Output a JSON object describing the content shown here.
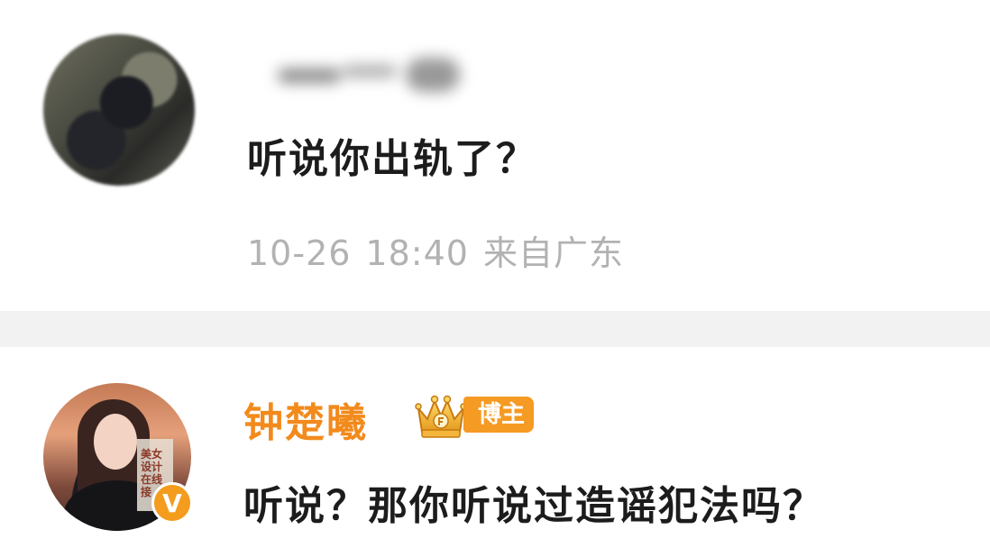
{
  "comment_1": {
    "username": "",
    "text": "听说你出轨了？",
    "date": "10-26",
    "time": "18:40",
    "location": "来自广东"
  },
  "comment_2": {
    "username": "钟楚曦",
    "badge_label": "博主",
    "text": "听说？那你听说过造谣犯法吗？",
    "avatar_poster_text": "美女设计 在线接",
    "verified_icon_glyph": "V"
  },
  "colors": {
    "username_orange": "#f28a1c",
    "badge_orange": "#f59a23",
    "meta_gray": "#b2b2b2",
    "divider_gray": "#f2f2f2",
    "text_dark": "#1c1c1c"
  }
}
